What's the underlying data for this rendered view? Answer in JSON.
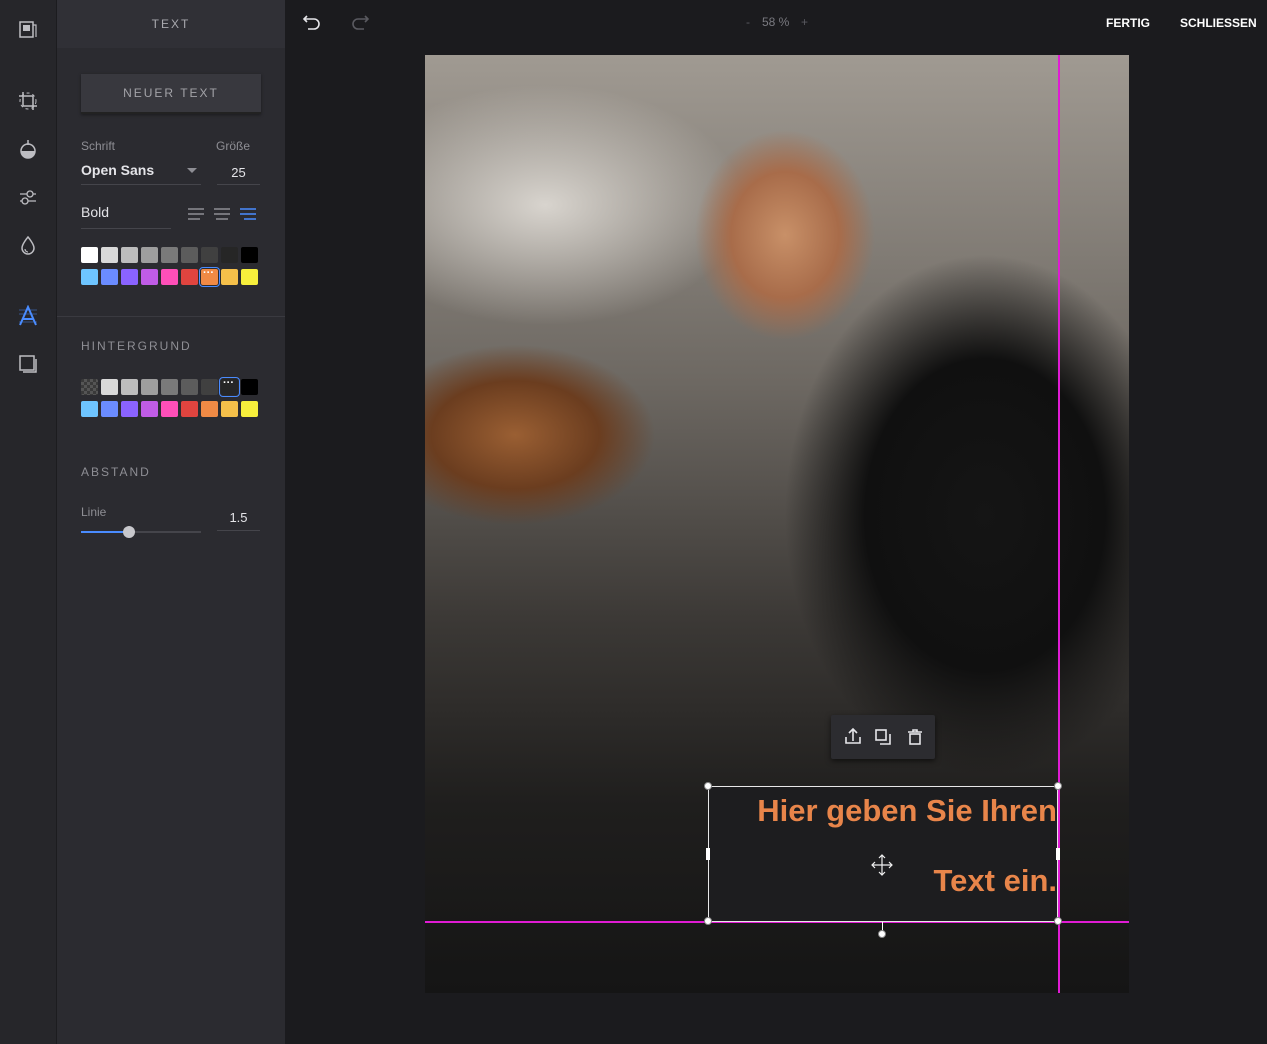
{
  "sidebar": {
    "tools": [
      {
        "name": "library-icon"
      },
      {
        "name": "crop-icon"
      },
      {
        "name": "filter-icon"
      },
      {
        "name": "adjust-icon"
      },
      {
        "name": "drop-icon"
      },
      {
        "name": "text-tool-icon",
        "active": true
      },
      {
        "name": "frame-icon"
      }
    ]
  },
  "panel": {
    "title": "TEXT",
    "new_text_button": "NEUER TEXT",
    "font_label": "Schrift",
    "font_value": "Open Sans",
    "size_label": "Größe",
    "size_value": "25",
    "style_value": "Bold",
    "alignment_selected": "right",
    "text_colors_row1": [
      "#ffffff",
      "#d9d9d9",
      "#bdbdbd",
      "#9e9e9e",
      "#7a7a7a",
      "#5c5c5c",
      "#404040",
      "#262626",
      "#000000"
    ],
    "text_colors_row2": [
      "#6ec5ff",
      "#6b8cff",
      "#8a63ff",
      "#c05ce6",
      "#ff4fb8",
      "#e0443f",
      "#f08a45",
      "#f5c04a",
      "#f7ef3c"
    ],
    "text_color_selected": "#f08a45",
    "background_title": "HINTERGRUND",
    "bg_colors_row1": [
      "transparent",
      "#d9d9d9",
      "#bdbdbd",
      "#9e9e9e",
      "#7a7a7a",
      "#5c5c5c",
      "#404040",
      "#262626",
      "#000000"
    ],
    "bg_colors_row2": [
      "#6ec5ff",
      "#6b8cff",
      "#8a63ff",
      "#c05ce6",
      "#ff4fb8",
      "#e0443f",
      "#f08a45",
      "#f5c04a",
      "#f7ef3c"
    ],
    "bg_color_selected": "#262626",
    "spacing_title": "ABSTAND",
    "line_label": "Linie",
    "line_value": "1.5",
    "line_slider_fraction": 0.4
  },
  "topbar": {
    "zoom_minus": "-",
    "zoom_value": "58 %",
    "zoom_plus": "+",
    "done": "FERTIG",
    "close": "SCHLIESSEN"
  },
  "canvas": {
    "text_line1": "Hier geben Sie Ihren",
    "text_line2": "Text ein.",
    "text_color": "#e8854a",
    "guide_color": "#e01bd4"
  }
}
